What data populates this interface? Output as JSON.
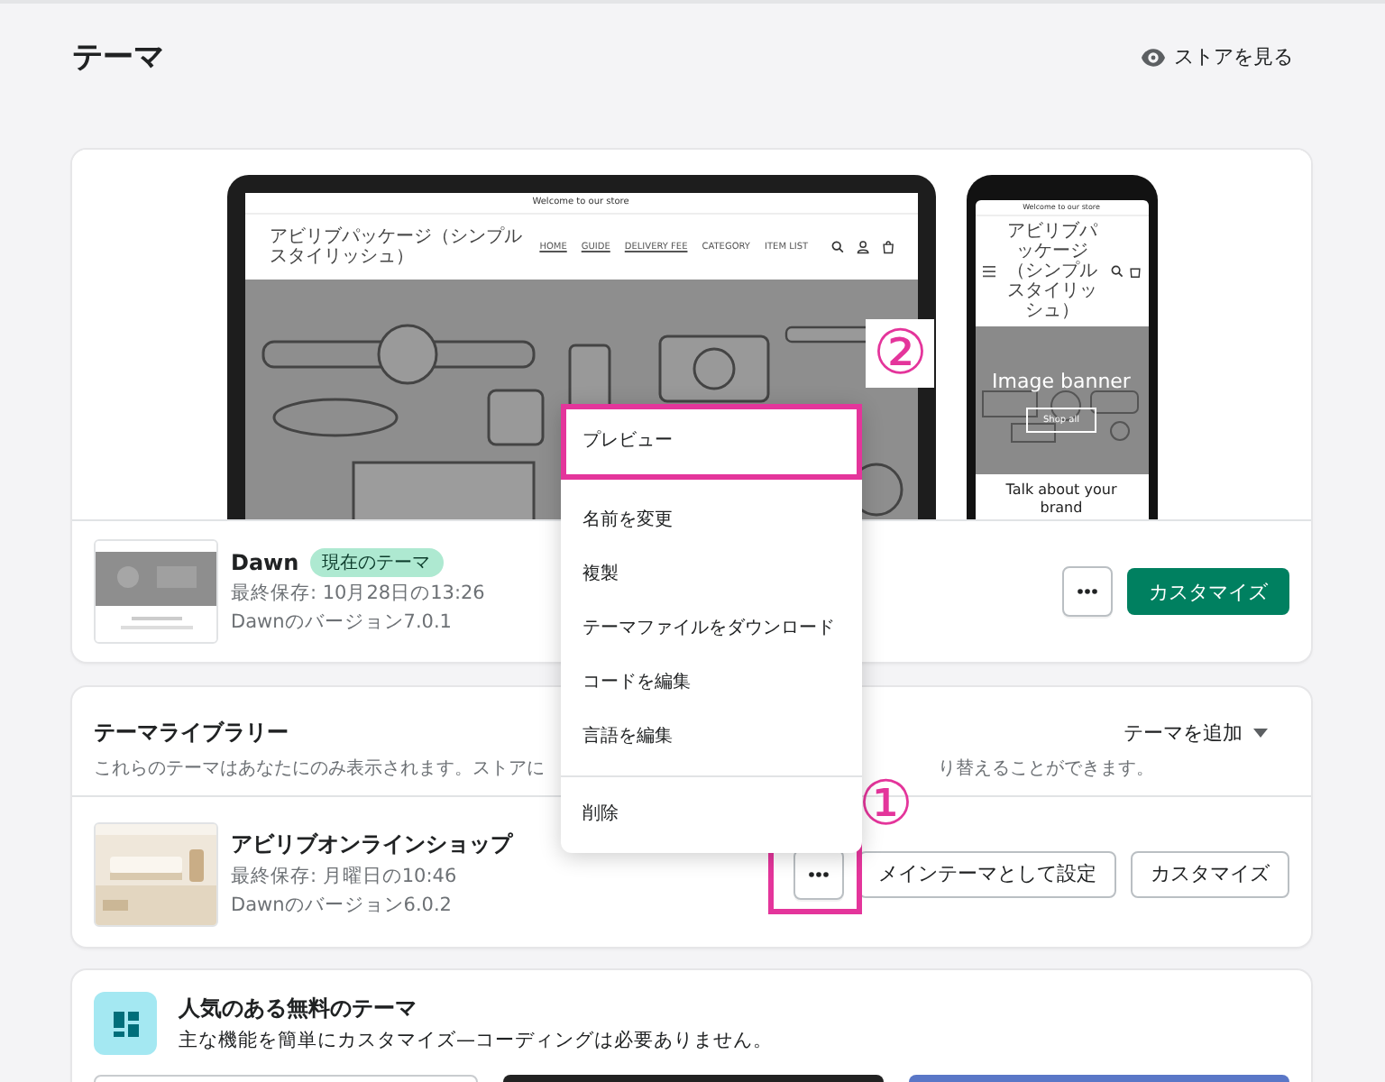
{
  "header": {
    "title": "テーマ",
    "view_store": "ストアを見る"
  },
  "current_theme": {
    "preview": {
      "desktop": {
        "announcement": "Welcome to our store",
        "store_name": "アビリブパッケージ（シンプルスタイリッシュ）",
        "nav": [
          {
            "label": "HOME",
            "underlined": true
          },
          {
            "label": "GUIDE",
            "underlined": true
          },
          {
            "label": "DELIVERY FEE",
            "underlined": true
          },
          {
            "label": "CATEGORY",
            "underlined": false
          },
          {
            "label": "ITEM LIST",
            "underlined": false
          }
        ]
      },
      "mobile": {
        "announcement": "Welcome to our store",
        "store_name": "アビリブパッケージ（シンプルスタイリッシュ）",
        "banner_title": "Image banner",
        "banner_button": "Shop all",
        "section_title": "Talk about your brand"
      }
    },
    "name": "Dawn",
    "badge": "現在のテーマ",
    "last_saved": "最終保存: 10月28日の13:26",
    "version": "Dawnのバージョン7.0.1",
    "customize_button": "カスタマイズ"
  },
  "menu": {
    "annotation": "②",
    "items": [
      {
        "label": "プレビュー",
        "highlighted": true,
        "separated": false
      },
      {
        "label": "名前を変更",
        "highlighted": false,
        "separated": false
      },
      {
        "label": "複製",
        "highlighted": false,
        "separated": false
      },
      {
        "label": "テーマファイルをダウンロード",
        "highlighted": false,
        "separated": false
      },
      {
        "label": "コードを編集",
        "highlighted": false,
        "separated": false
      },
      {
        "label": "言語を編集",
        "highlighted": false,
        "separated": false
      },
      {
        "label": "削除",
        "highlighted": false,
        "separated": true
      }
    ]
  },
  "library": {
    "title": "テーマライブラリー",
    "add_theme": "テーマを追加",
    "description_start": "これらのテーマはあなたにのみ表示されます。ストアに",
    "description_end": "り替えることができます。",
    "themes": [
      {
        "name": "アビリブオンラインショップ",
        "last_saved": "最終保存: 月曜日の10:46",
        "version": "Dawnのバージョン6.0.2",
        "more_highlighted": true,
        "annotation": "①",
        "publish_button": "メインテーマとして設定",
        "customize_button": "カスタマイズ"
      }
    ]
  },
  "free_themes": {
    "title": "人気のある無料のテーマ",
    "subtitle": "主な機能を簡単にカスタマイズ—コーディングは必要ありません。"
  }
}
